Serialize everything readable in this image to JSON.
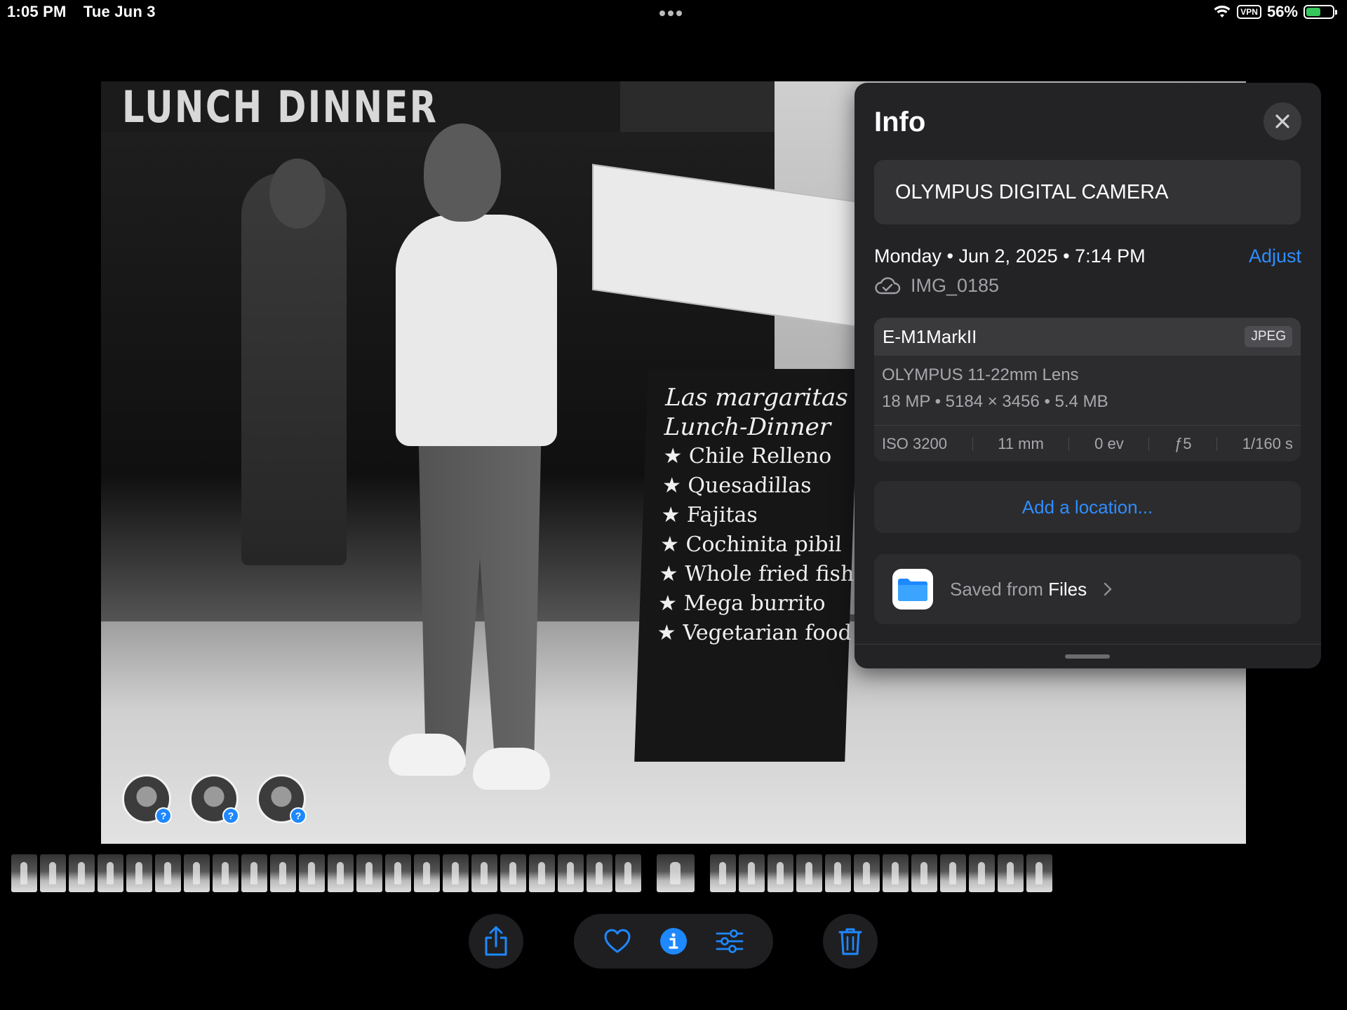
{
  "status_bar": {
    "time": "1:05 PM",
    "date": "Tue Jun 3",
    "vpn": "VPN",
    "battery": "56%",
    "battery_level": 0.56,
    "icons": [
      "wifi-icon",
      "vpn-badge",
      "battery-charging-icon"
    ]
  },
  "photo": {
    "sign_top": "LUNCH  DINNER",
    "board_lines": [
      "Las margaritas",
      "Lunch-Dinner",
      "★ Chile Relleno",
      "★ Quesadillas",
      "★ Fajitas",
      "★ Cochinita pibil",
      "★ Whole fried fish",
      "★ Mega burrito",
      "★ Vegetarian food"
    ],
    "face_badge": "?",
    "faces_count": 3
  },
  "info_panel": {
    "title": "Info",
    "caption": "OLYMPUS DIGITAL CAMERA",
    "date_line": "Monday • Jun 2, 2025 • 7:14 PM",
    "adjust": "Adjust",
    "filename": "IMG_0185",
    "camera": "E-M1MarkII",
    "format": "JPEG",
    "lens": "OLYMPUS 11-22mm Lens",
    "specs": "18 MP • 5184 × 3456 • 5.4 MB",
    "exif": [
      "ISO 3200",
      "11 mm",
      "0 ev",
      "ƒ5",
      "1/160 s"
    ],
    "add_location": "Add a location...",
    "saved_prefix": "Saved from",
    "saved_app": "Files",
    "accent_color": "#2f8dff"
  },
  "filmstrip": {
    "group1_count": 22,
    "group2_count": 1,
    "group3_count": 12
  },
  "toolbar": {
    "icons": [
      "share-icon",
      "heart-icon",
      "info-icon",
      "adjust-sliders-icon",
      "trash-icon"
    ]
  }
}
